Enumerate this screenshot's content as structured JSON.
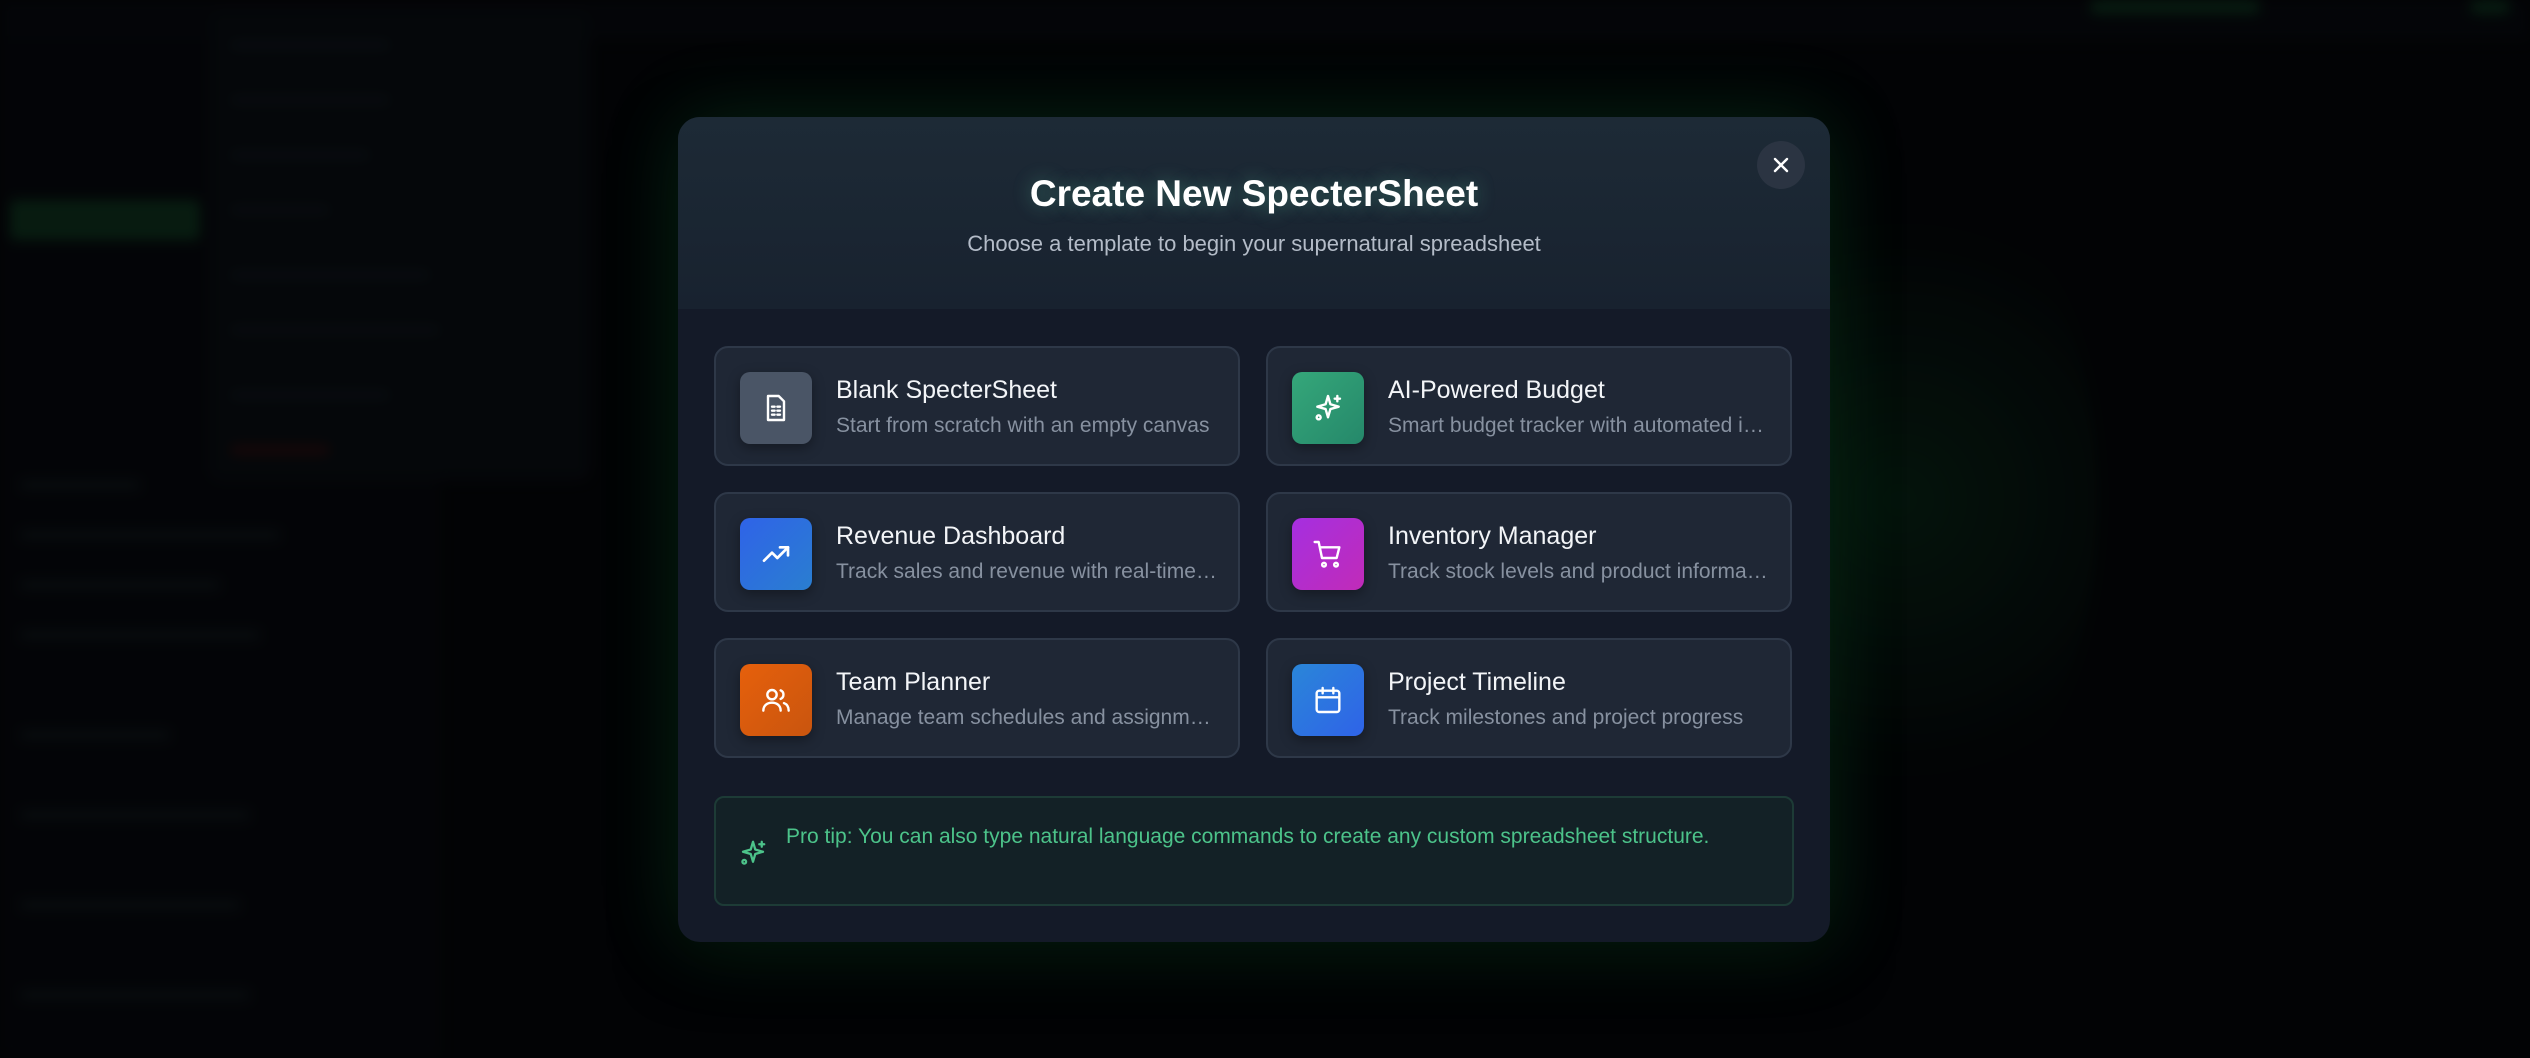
{
  "modal": {
    "title": "Create New SpecterSheet",
    "subtitle": "Choose a template to begin your supernatural spreadsheet",
    "close_icon": "close-icon"
  },
  "templates": [
    {
      "title": "Blank SpecterSheet",
      "description": "Start from scratch with an empty canvas",
      "icon": "document-icon",
      "color": "#4a5566"
    },
    {
      "title": "AI-Powered Budget",
      "description": "Smart budget tracker with automated insights",
      "icon": "sparkles-icon",
      "color": "#2f9e72"
    },
    {
      "title": "Revenue Dashboard",
      "description": "Track sales and revenue with real-time metrics",
      "icon": "trending-up-icon",
      "color": "#2f6fe6"
    },
    {
      "title": "Inventory Manager",
      "description": "Track stock levels and product information",
      "icon": "cart-icon",
      "color": "#b02fd6"
    },
    {
      "title": "Team Planner",
      "description": "Manage team schedules and assignments",
      "icon": "users-icon",
      "color": "#e0600f"
    },
    {
      "title": "Project Timeline",
      "description": "Track milestones and project progress",
      "icon": "calendar-icon",
      "color": "#2f7de0"
    }
  ],
  "tip": {
    "label": "Pro tip:",
    "text": " You can also type natural language commands to create any custom spreadsheet structure.",
    "icon": "sparkles-icon"
  },
  "colors": {
    "accent": "#22c55e",
    "tip_text": "#4cc38a"
  }
}
